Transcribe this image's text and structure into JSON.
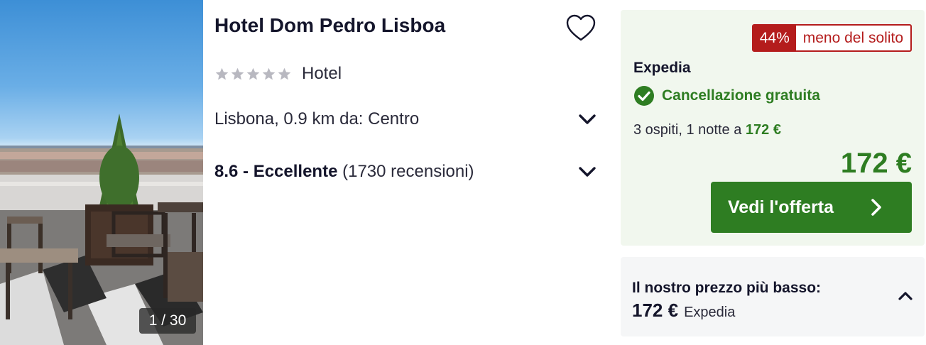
{
  "photo": {
    "counter": "1 / 30"
  },
  "hotel": {
    "name": "Hotel Dom Pedro Lisboa",
    "stars": 5,
    "stars_filled": 0,
    "category": "Hotel",
    "location": "Lisbona, 0.9 km da: Centro",
    "rating_score": "8.6 - Eccellente",
    "rating_reviews": "(1730 recensioni)"
  },
  "deal": {
    "discount_pct": "44%",
    "discount_text": "meno del solito",
    "provider": "Expedia",
    "cancellation": "Cancellazione gratuita",
    "guests_text": "3 ospiti, 1 notte a",
    "guests_price": "172 €",
    "price": "172 €",
    "cta_label": "Vedi l'offerta"
  },
  "lowest": {
    "label": "Il nostro prezzo più basso:",
    "price": "172 €",
    "provider": "Expedia"
  },
  "colors": {
    "brand_green": "#2e7d22",
    "discount_red": "#b41c1c",
    "deal_bg": "#f1f7ee",
    "star_grey": "#b8b8c0"
  },
  "icons": {
    "favorite": "heart-outline-icon",
    "chevron": "chevron-down-icon",
    "check": "check-circle-icon",
    "cta_arrow": "chevron-right-icon",
    "collapse": "chevron-up-icon"
  }
}
